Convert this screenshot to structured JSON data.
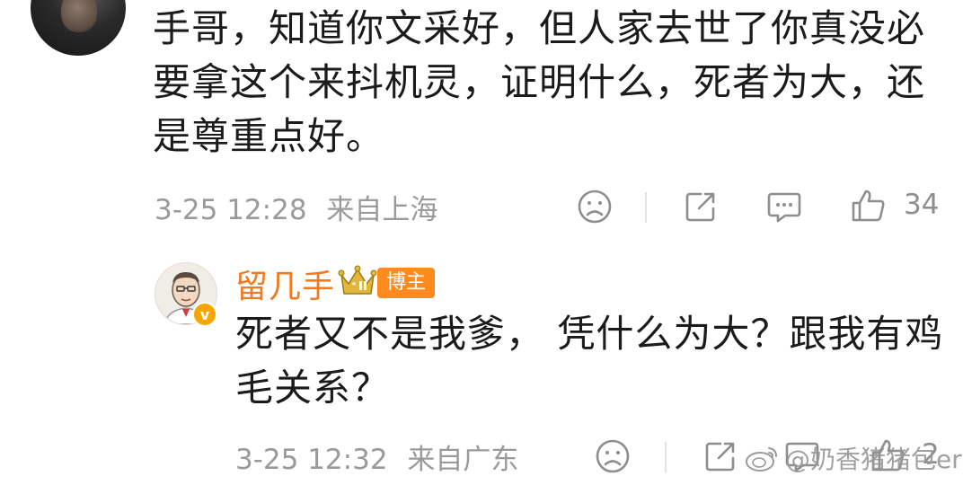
{
  "comment1": {
    "text": "手哥，知道你文采好，但人家去世了你真没必要拿这个来抖机灵，证明什么，死者为大，还是尊重点好。",
    "time": "3-25 12:28",
    "location": "来自上海",
    "like_count": "34"
  },
  "reply": {
    "username": "留几手",
    "badge": "博主",
    "text": "死者又不是我爹， 凭什么为大？跟我有鸡毛关系？",
    "time": "3-25 12:32",
    "location": "来自广东",
    "like_count": "2"
  },
  "watermark": "@奶香猪猪包er",
  "colors": {
    "username": "#f07b22",
    "badge": "#ff8a1d",
    "meta": "#9a9a9a",
    "crown": "#c99a1a"
  },
  "icons": [
    "sad-face-icon",
    "share-icon",
    "comment-icon",
    "thumbs-up-icon",
    "crown-icon",
    "verified-v-icon",
    "weibo-logo-icon"
  ]
}
